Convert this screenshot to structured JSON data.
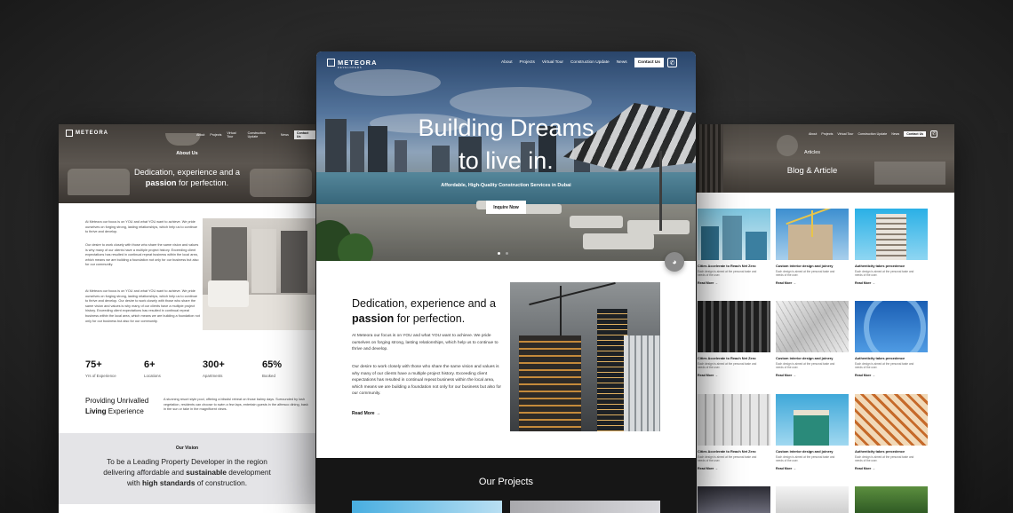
{
  "brand": {
    "name": "METEORA",
    "sub": "DEVELOPERS"
  },
  "nav": {
    "items": [
      "About",
      "Projects",
      "Virtual Tour",
      "Construction Update",
      "News"
    ],
    "contact_label": "Contact Us",
    "whatsapp_icon": "whatsapp-icon"
  },
  "left_page": {
    "hero_title": "About Us",
    "hero_line1": "Dedication, experience and a",
    "hero_bold": "passion",
    "hero_line2": "for perfection.",
    "para1": "At Meteora our focus is on YOU and what YOU want to achieve. We pride ourselves on forging strong, lasting relationships, which help us to continue to thrive and develop.",
    "para2": "Our desire to work closely with those who share the same vision and values is why many of our clients have a multiple project history. Exceeding client expectations has resulted in continual repeat business within the local area, which means we are building a foundation not only for our business but also for our community.",
    "para3": "At Meteora our focus is on YOU and what YOU want to achieve. We pride ourselves on forging strong, lasting relationships, which help us to continue to thrive and develop. Our desire to work closely with those who share the same vision and values is why many of our clients have a multiple project history. Exceeding client expectations has resulted in continual repeat business within the local area, which means we are building a foundation not only for our business but also for our community.",
    "stats": [
      {
        "value": "75+",
        "label": "Yrs of Experience"
      },
      {
        "value": "6+",
        "label": "Locations"
      },
      {
        "value": "300+",
        "label": "Apartments"
      },
      {
        "value": "65%",
        "label": "Booked"
      }
    ],
    "unrivalled_line1": "Providing Unrivalled",
    "unrivalled_bold": "Living",
    "unrivalled_line2": "Experience",
    "unrivalled_text": "A stunning resort style pool, offering a blissful retreat on those balmy days. Surrounded by lush vegetation, residents can choose to swim a few laps, entertain guests in the alfresco dining, bask in the sun or take in the magnificent views.",
    "vision_title": "Our Vision",
    "vision_line1": "To be a Leading Property Developer in the region",
    "vision_line2a": "delivering affordable and",
    "vision_bold1": "sustainable",
    "vision_line2b": "development",
    "vision_line3a": "with",
    "vision_bold2": "high standards",
    "vision_line3b": "of construction."
  },
  "center_page": {
    "hero_title_line1": "Building Dreams",
    "hero_title_line2": "to live in.",
    "hero_subtitle": "Affordable, High-Quality Construction Services in Dubai",
    "inquire_label": "Inquire Now",
    "section_line1": "Dedication, experience and a",
    "section_bold": "passion",
    "section_line2": "for perfection.",
    "para1": "At Meteora our focus is on YOU and what YOU want to achieve. We pride ourselves on forging strong, lasting relationships, which help us to continue to thrive and develop.",
    "para2": "Our desire to work closely with those who share the same vision and values is why many of our clients have a multiple project history. Exceeding client expectations has resulted in continual repeat business within the local area, which means we are building a foundation not only for our business but also for our community.",
    "read_more": "Read More",
    "projects_title": "Our Projects"
  },
  "right_page": {
    "hero_small": "Articles",
    "hero_title": "Blog & Article",
    "articles": [
      {
        "title": "Cities Accelerate to Reach Net Zero",
        "desc": "Each design is aimed at the personal taste and needs of the user.",
        "read": "Read More"
      },
      {
        "title": "Custom interior design and joinery",
        "desc": "Each design is aimed at the personal taste and needs of the user.",
        "read": "Read More"
      },
      {
        "title": "Authenticity takes precedence",
        "desc": "Each design is aimed at the personal taste and needs of the user.",
        "read": "Read More"
      },
      {
        "title": "Cities Accelerate to Reach Net Zero",
        "desc": "Each design is aimed at the personal taste and needs of the user.",
        "read": "Read More"
      },
      {
        "title": "Custom interior design and joinery",
        "desc": "Each design is aimed at the personal taste and needs of the user.",
        "read": "Read More"
      },
      {
        "title": "Authenticity takes precedence",
        "desc": "Each design is aimed at the personal taste and needs of the user.",
        "read": "Read More"
      },
      {
        "title": "Cities Accelerate to Reach Net Zero",
        "desc": "Each design is aimed at the personal taste and needs of the user.",
        "read": "Read More"
      },
      {
        "title": "Custom interior design and joinery",
        "desc": "Each design is aimed at the personal taste and needs of the user.",
        "read": "Read More"
      },
      {
        "title": "Authenticity takes precedence",
        "desc": "Each design is aimed at the personal taste and needs of the user.",
        "read": "Read More"
      }
    ]
  },
  "colors": {
    "dark": "#161616",
    "vision_bg": "#e4e4e7",
    "accent_blue": "#2b8fc9"
  }
}
